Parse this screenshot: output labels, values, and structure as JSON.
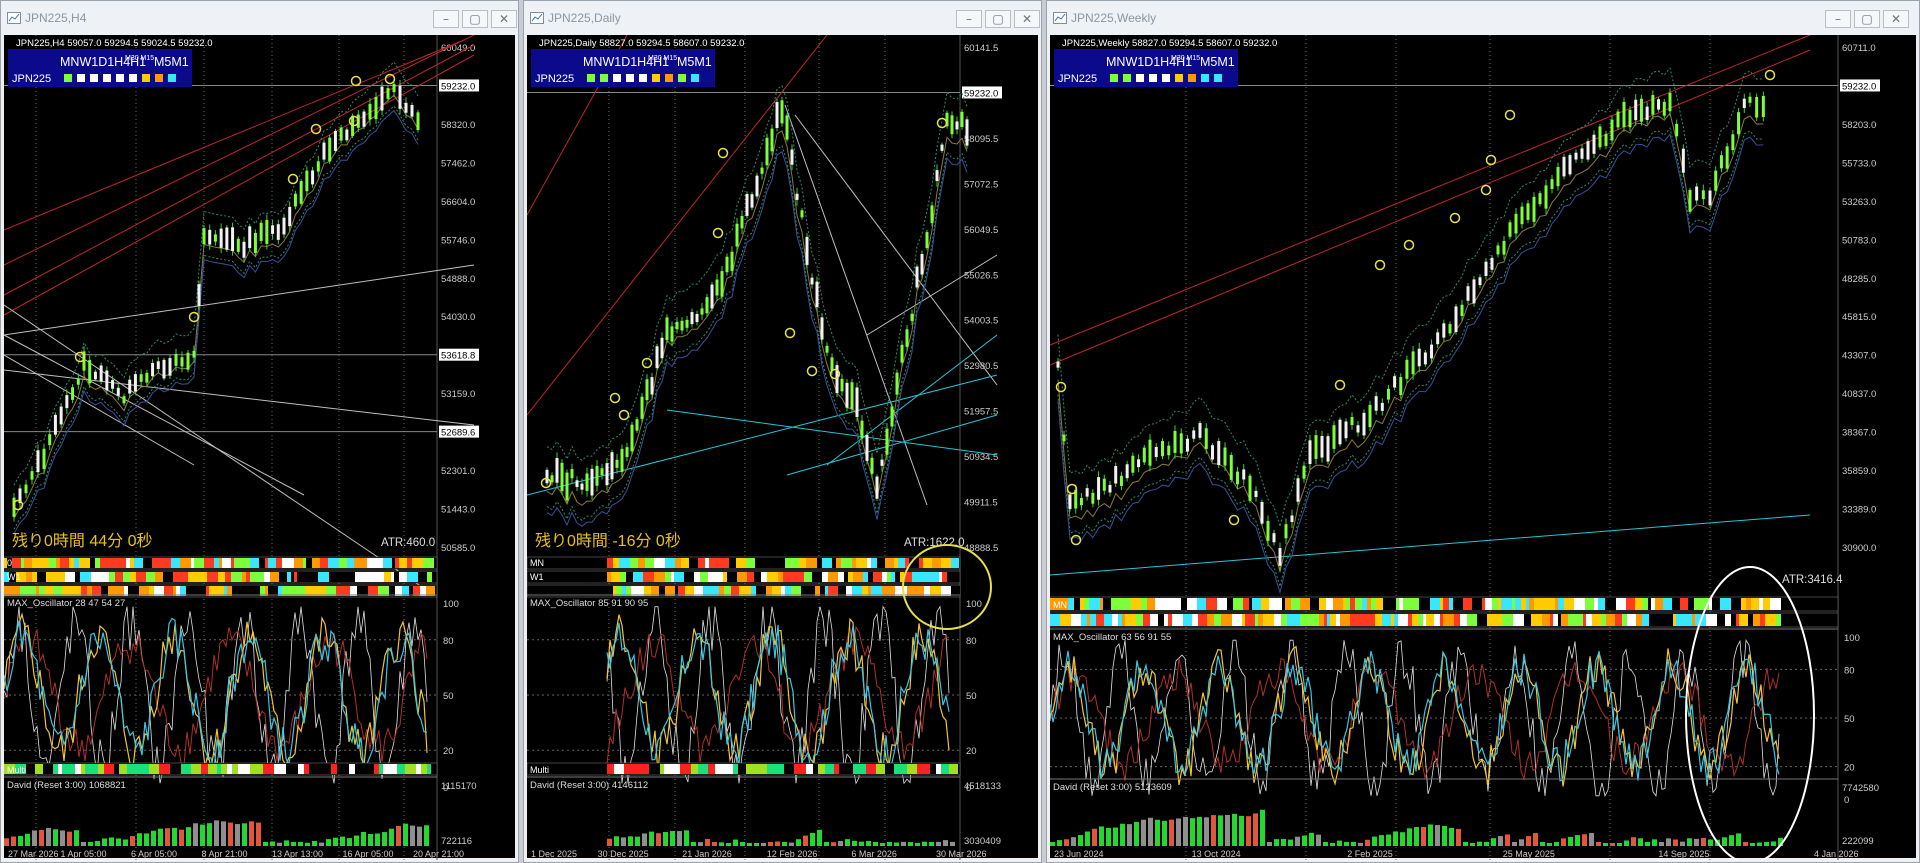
{
  "windows": [
    {
      "title": "JPN225,H4",
      "ohlc": "JPN225,H4  59057.0 59294.5 59024.5 59232.0",
      "symbol": "JPN225",
      "timeframes": "MNW1D1H4H1",
      "tf_small": "M30 M15",
      "tf_tail": "M5M1",
      "tf_colors": [
        "#7cff3a",
        "#ffffff",
        "#ffffff",
        "#ffffff",
        "#ffffff",
        "#ffffff",
        "#ffcc00",
        "#ff9900",
        "#39e6ff"
      ],
      "price_labels": [
        "60049.0",
        "59232.0",
        "58320.0",
        "57462.0",
        "56604.0",
        "55746.0",
        "54888.0",
        "54030.0",
        "53618.8",
        "53159.0",
        "52689.6",
        "52301.0",
        "51443.0",
        "50585.0"
      ],
      "current_price": "59232.0",
      "remaining": "残り0時間 44分 0秒",
      "atr": "ATR:460.0",
      "strip_labels": [
        "0",
        "W1",
        ""
      ],
      "osc_label": "MAX_Oscillator 28 47 54 27",
      "osc_levels": [
        "100",
        "80",
        "50",
        "20",
        "0"
      ],
      "multi_label": "Multi",
      "david_label": "David (Reset 3:00) 1068821",
      "david_levels": [
        "1115170",
        "722116"
      ],
      "dates": [
        "27 Mar 2026",
        "1 Apr 05:00",
        "6 Apr 05:00",
        "8 Apr 21:00",
        "13 Apr 13:00",
        "16 Apr 05:00",
        "20 Apr 21:00"
      ]
    },
    {
      "title": "JPN225,Daily",
      "ohlc": "JPN225,Daily  58827.0 59294.5 58607.0 59232.0",
      "symbol": "JPN225",
      "timeframes": "MNW1D1H4H1",
      "tf_small": "M30 M15",
      "tf_tail": "M5M1",
      "tf_colors": [
        "#7cff3a",
        "#7cff3a",
        "#ffffff",
        "#ffffff",
        "#ffffff",
        "#ffcc00",
        "#ff9900",
        "#7cff3a",
        "#39e6ff"
      ],
      "price_labels": [
        "60141.5",
        "59232.0",
        "58095.5",
        "57072.5",
        "56049.5",
        "55026.5",
        "54003.5",
        "52980.5",
        "51957.5",
        "50934.5",
        "49911.5",
        "48888.5"
      ],
      "current_price": "59232.0",
      "remaining": "残り0時間 -16分 0秒",
      "atr": "ATR:1622.0",
      "strip_labels": [
        "MN",
        "W1",
        ""
      ],
      "osc_label": "MAX_Oscillator 85 91 90 95",
      "osc_levels": [
        "100",
        "80",
        "50",
        "20",
        "0"
      ],
      "multi_label": "Multi",
      "david_label": "David (Reset 3:00) 4146112",
      "david_levels": [
        "4518133",
        "3030409"
      ],
      "dates": [
        "1 Dec 2025",
        "30 Dec 2025",
        "21 Jan 2026",
        "12 Feb 2026",
        "6 Mar 2026",
        "30 Mar 2026"
      ]
    },
    {
      "title": "JPN225,Weekly",
      "ohlc": "JPN225,Weekly  58827.0 59294.5 58607.0 59232.0",
      "symbol": "JPN225",
      "timeframes": "MNW1D1H4H1",
      "tf_small": "M30 M15",
      "tf_tail": "M5M1",
      "tf_colors": [
        "#7cff3a",
        "#7cff3a",
        "#ffffff",
        "#ffffff",
        "#ffffff",
        "#ffcc00",
        "#ff9900",
        "#39e6ff",
        "#39e6ff"
      ],
      "price_labels": [
        "60711.0",
        "59232.0",
        "58203.0",
        "55733.0",
        "53263.0",
        "50783.0",
        "48285.0",
        "45815.0",
        "43307.0",
        "40837.0",
        "38367.0",
        "35859.0",
        "33389.0",
        "30900.0"
      ],
      "current_price": "59232.0",
      "remaining": "",
      "atr": "ATR:3416.4",
      "strip_labels": [
        "MN",
        ""
      ],
      "osc_label": "MAX_Oscillator 63 56 91 55",
      "osc_levels": [
        "100",
        "80",
        "50",
        "20",
        "0"
      ],
      "multi_label": "",
      "david_label": "David (Reset 3:00) 5123609",
      "david_levels": [
        "7742580",
        "222099"
      ],
      "dates": [
        "23 Jun 2024",
        "13 Oct 2024",
        "2 Feb 2025",
        "25 May 2025",
        "14 Sep 2025",
        "4 Jan 2026"
      ]
    }
  ],
  "window_controls": {
    "minimize": "–",
    "maximize": "▢",
    "close": "✕"
  },
  "colors": {
    "bull": "#7cff3a",
    "bear": "#ffffff",
    "trend_red": "#c0262b",
    "signal_yellow": "#e6e04a",
    "cyan": "#25c6d6"
  }
}
